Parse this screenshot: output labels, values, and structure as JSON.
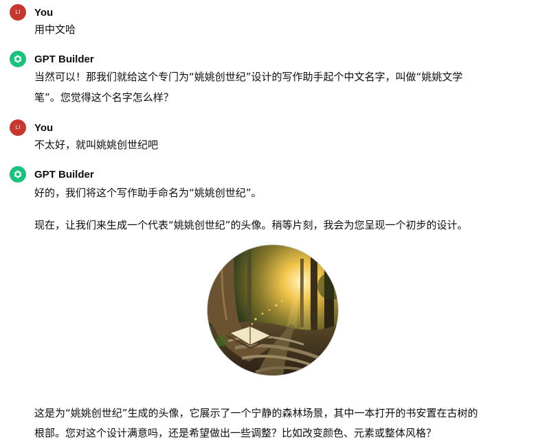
{
  "messages": [
    {
      "author": "You",
      "initials": "LI",
      "text": "用中文哈"
    },
    {
      "author": "GPT Builder",
      "line1": "当然可以！那我们就给这个专门为“姚姚创世纪”设计的写作助手起个中文名字，叫做“姚姚文学",
      "line2": "笔”。您觉得这个名字怎么样？"
    },
    {
      "author": "You",
      "initials": "LI",
      "text": "不太好，就叫姚姚创世纪吧"
    },
    {
      "author": "GPT Builder",
      "para1": "好的，我们将这个写作助手命名为“姚姚创世纪”。",
      "para2": "现在，让我们来生成一个代表“姚姚创世纪”的头像。稍等片刻，我会为您呈现一个初步的设计。",
      "image_icon": "forest-book-avatar-image",
      "para3_line1": "这是为“姚姚创世纪”生成的头像，它展示了一个宁静的森林场景，其中一本打开的书安置在古树的",
      "para3_line2": "根部。您对这个设计满意吗，还是希望做出一些调整？比如改变颜色、元素或整体风格？"
    }
  ],
  "colors": {
    "user_avatar": "#c8372d",
    "bot_avatar": "#19c37d",
    "text": "#0d0d0d"
  }
}
